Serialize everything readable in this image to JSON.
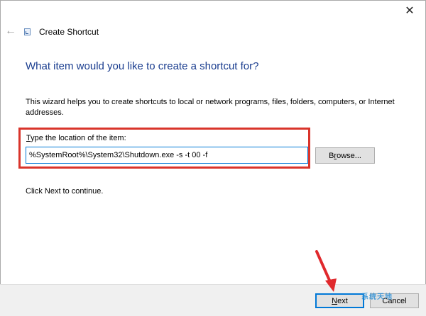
{
  "window": {
    "title": "Create Shortcut",
    "close_glyph": "✕",
    "back_glyph": "←",
    "back_icon": "back-arrow-icon",
    "app_icon": "shortcut-wizard-icon"
  },
  "page": {
    "heading": "What item would you like to create a shortcut for?",
    "description": "This wizard helps you to create shortcuts to local or network programs, files, folders, computers, or Internet addresses.",
    "location_label_accel": "T",
    "location_label_rest": "ype the location of the item:",
    "location_value": "%SystemRoot%\\System32\\Shutdown.exe -s -t 00 -f",
    "browse_accel": "r",
    "browse_label_pre": "B",
    "browse_label_post": "owse...",
    "continue_text": "Click Next to continue."
  },
  "footer": {
    "next_accel": "N",
    "next_label_rest": "ext",
    "cancel_label": "Cancel"
  },
  "annotations": {
    "highlight_color": "#d9342b",
    "arrow_color": "#e0292d"
  },
  "watermark": {
    "text": "系统天地"
  }
}
